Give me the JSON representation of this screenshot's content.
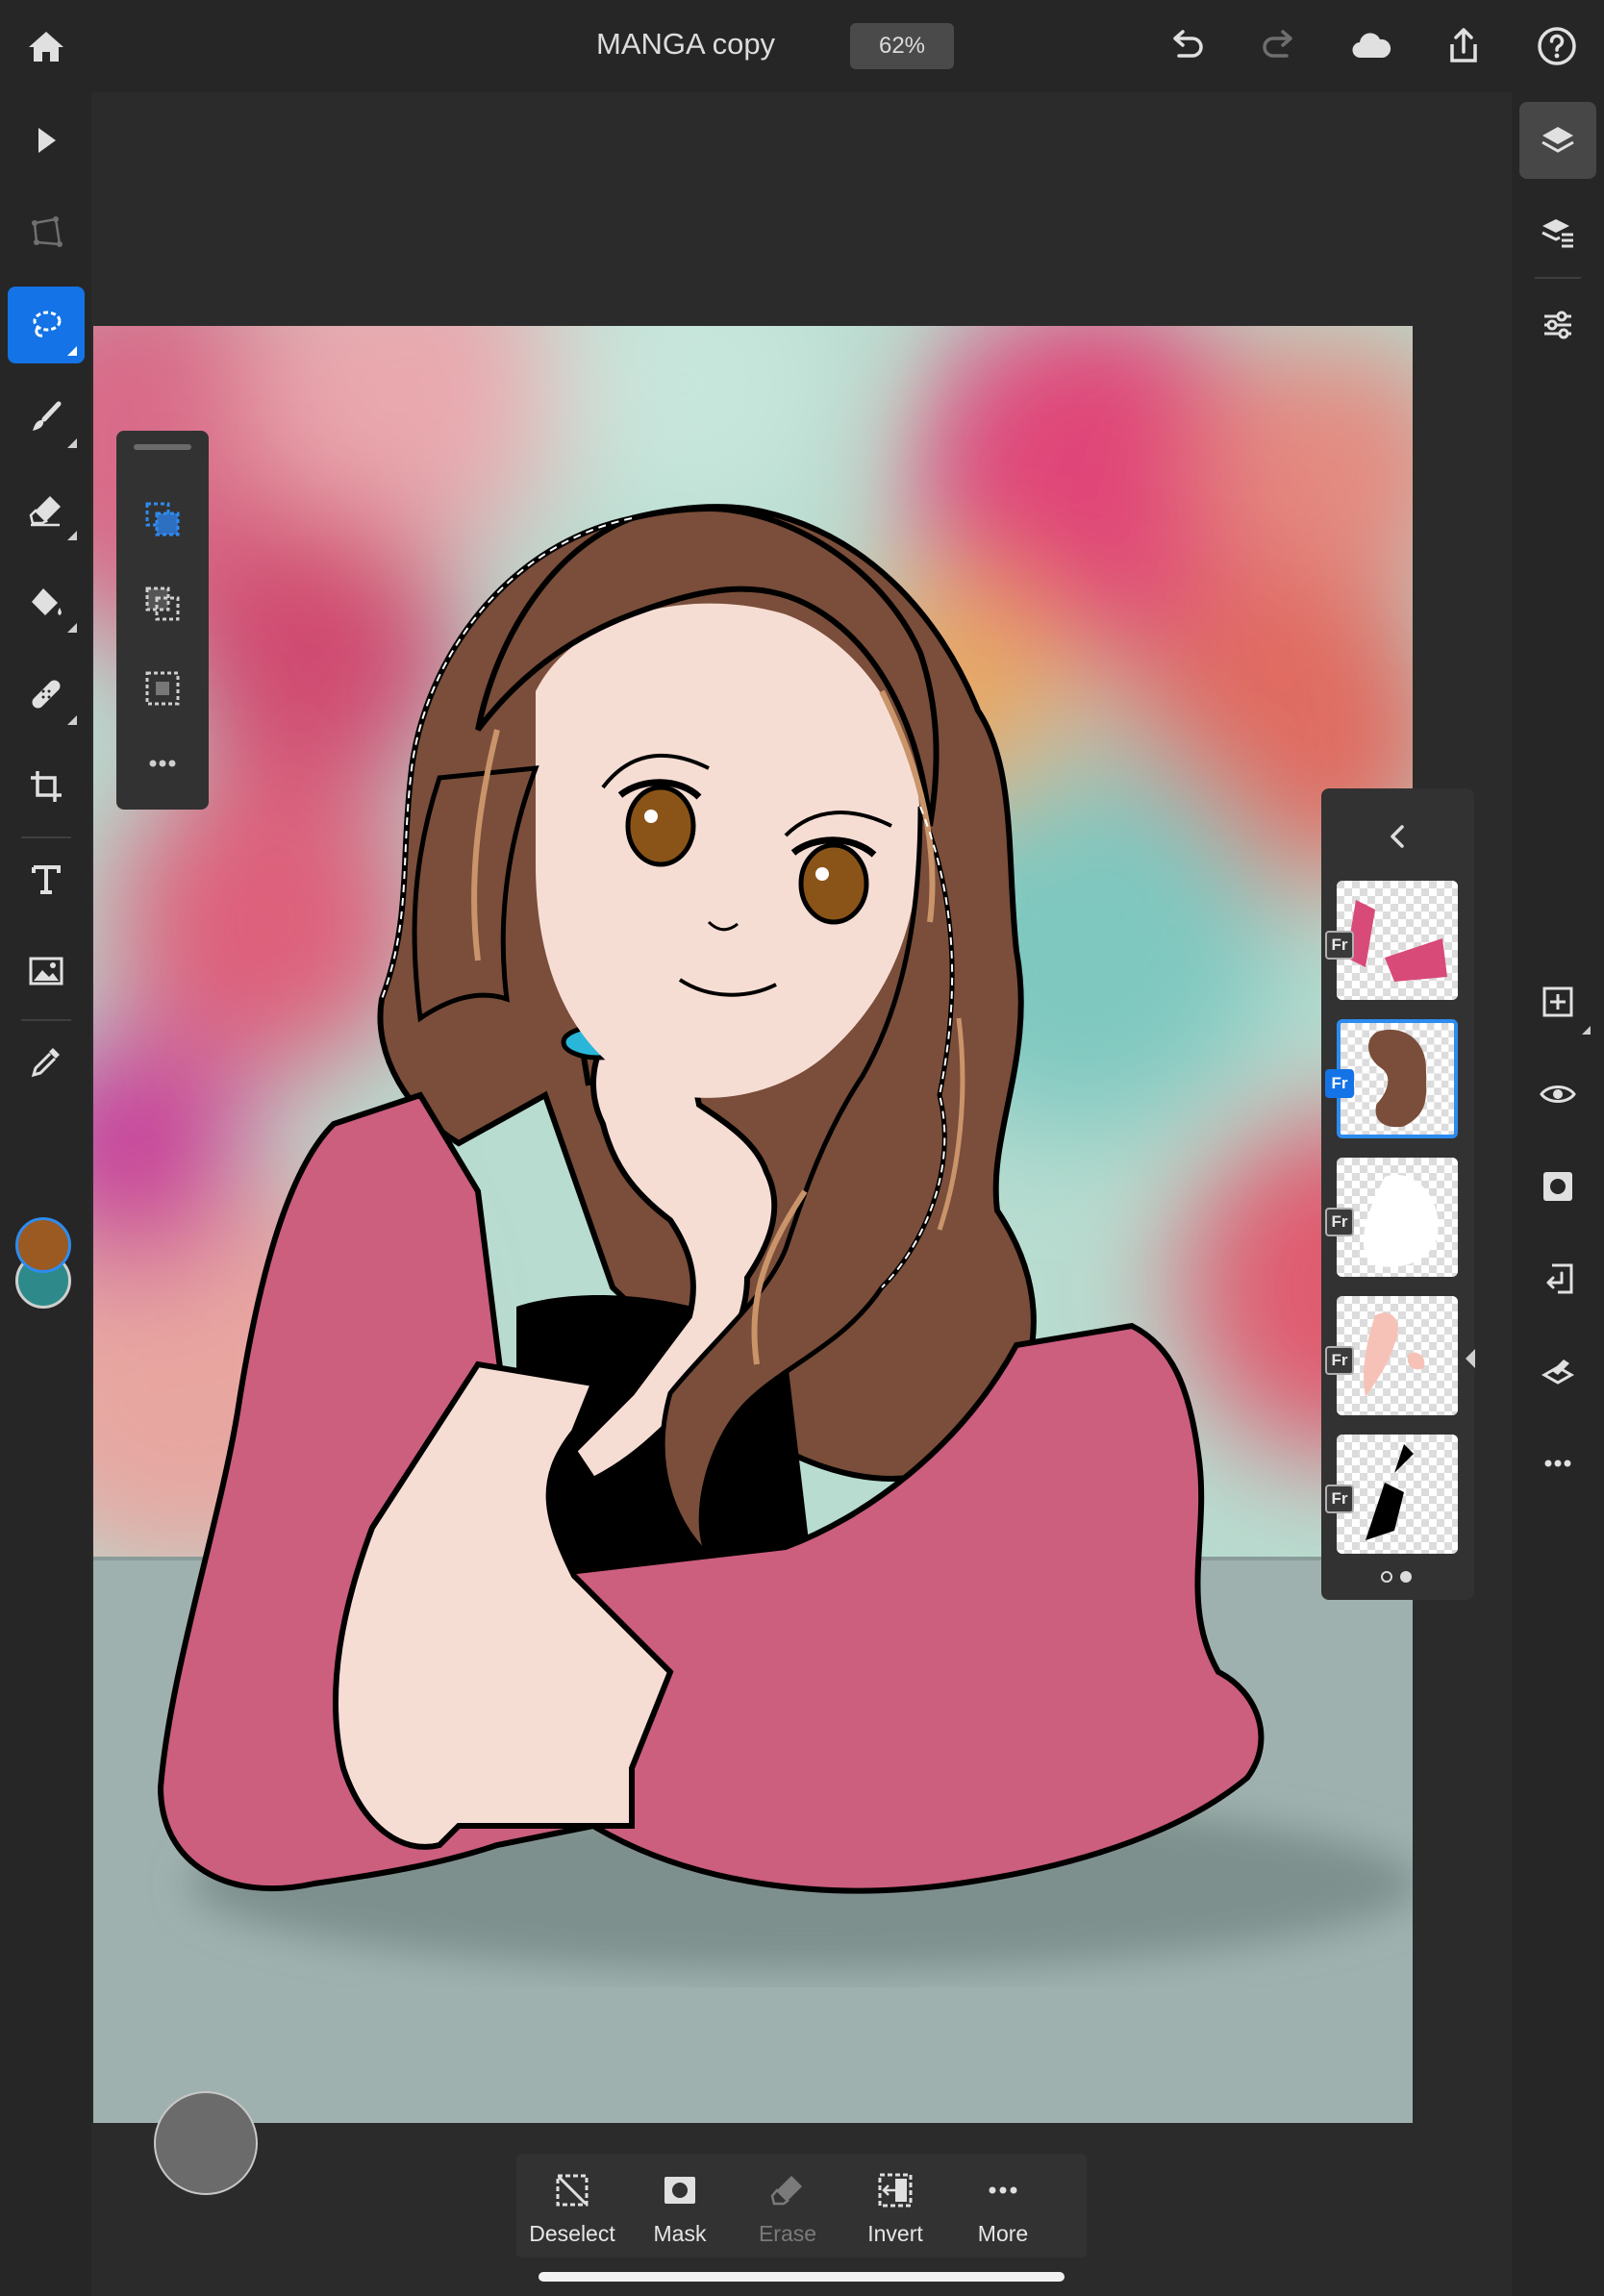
{
  "document": {
    "title": "MANGA copy",
    "zoom": "62%"
  },
  "top_bar": {
    "left_icons": [
      "home-icon"
    ],
    "right_icons": [
      "undo-icon",
      "redo-icon",
      "cloud-icon",
      "share-icon",
      "help-icon"
    ]
  },
  "left_toolbar": {
    "tools": [
      "select-arrow-icon",
      "transform-icon",
      "lasso-select-icon",
      "brush-icon",
      "eraser-icon",
      "fill-bucket-icon",
      "healing-icon",
      "crop-icon",
      "type-icon",
      "image-icon",
      "eyedropper-icon"
    ],
    "active_tool": "lasso-select-icon",
    "foreground_color": "#9a5a22",
    "background_color": "#2e8a8a"
  },
  "right_toolbar": {
    "tools": [
      "layers-icon",
      "layer-properties-icon",
      "adjustments-icon",
      "add-layer-icon",
      "visibility-icon",
      "mask-icon",
      "merge-down-icon",
      "clear-icon",
      "more-icon"
    ],
    "active_tool": "layers-icon"
  },
  "selection_palette": {
    "buttons": [
      "new-selection-icon",
      "add-to-selection-icon",
      "subtract-selection-icon",
      "more-options-icon"
    ]
  },
  "layers_panel": {
    "layers": [
      {
        "badge": "Fr",
        "content": "pink-shawl",
        "selected": false
      },
      {
        "badge": "Fr",
        "content": "brown-hair",
        "selected": true
      },
      {
        "badge": "Fr",
        "content": "white-skin-base",
        "selected": false
      },
      {
        "badge": "Fr",
        "content": "skin-tone",
        "selected": false
      },
      {
        "badge": "Fr",
        "content": "black-lineart",
        "selected": false
      }
    ]
  },
  "bottom_bar": {
    "deselect_label": "Deselect",
    "mask_label": "Mask",
    "erase_label": "Erase",
    "invert_label": "Invert",
    "more_label": "More"
  },
  "colors": {
    "accent": "#1473e6",
    "toolbar_bg": "#262626",
    "panel_bg": "#323232"
  }
}
